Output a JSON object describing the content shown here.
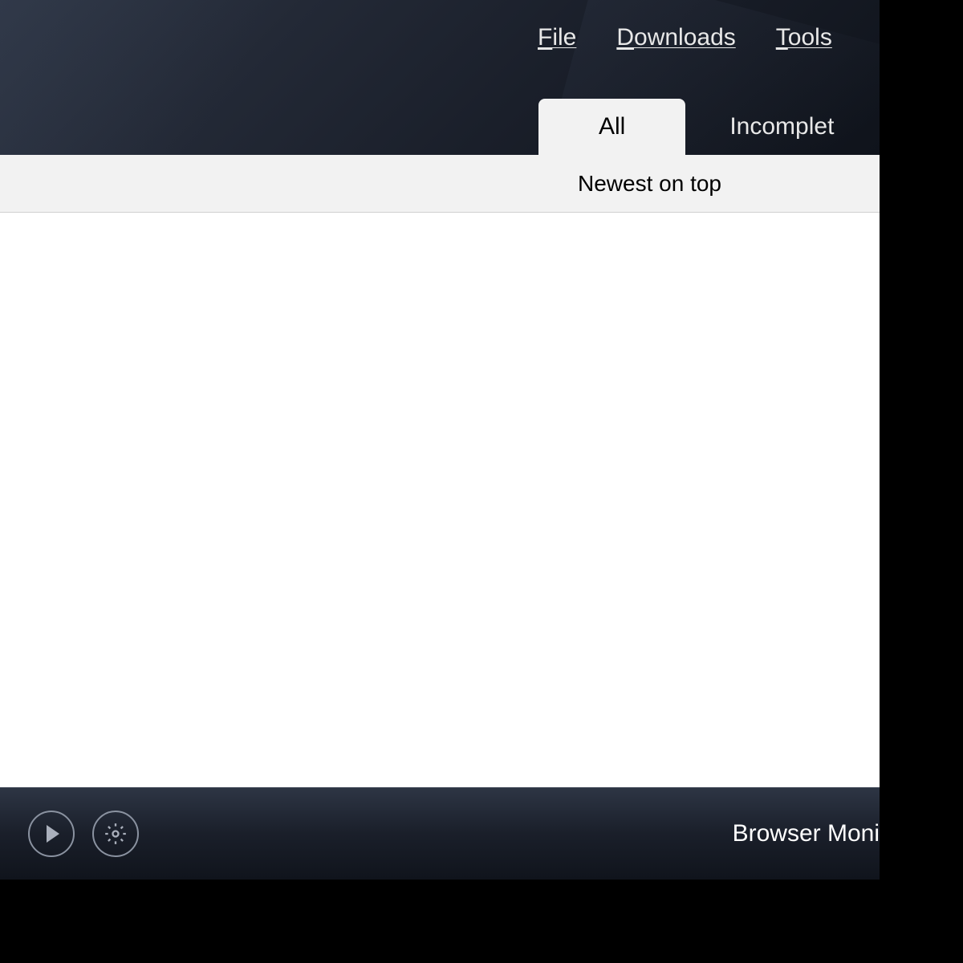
{
  "menu": {
    "file": "File",
    "downloads": "Downloads",
    "tools": "Tools"
  },
  "tabs": {
    "all": "All",
    "incomplete": "Incomplet"
  },
  "sort": {
    "label": "Newest on top"
  },
  "footer": {
    "status": "Browser Moni"
  }
}
